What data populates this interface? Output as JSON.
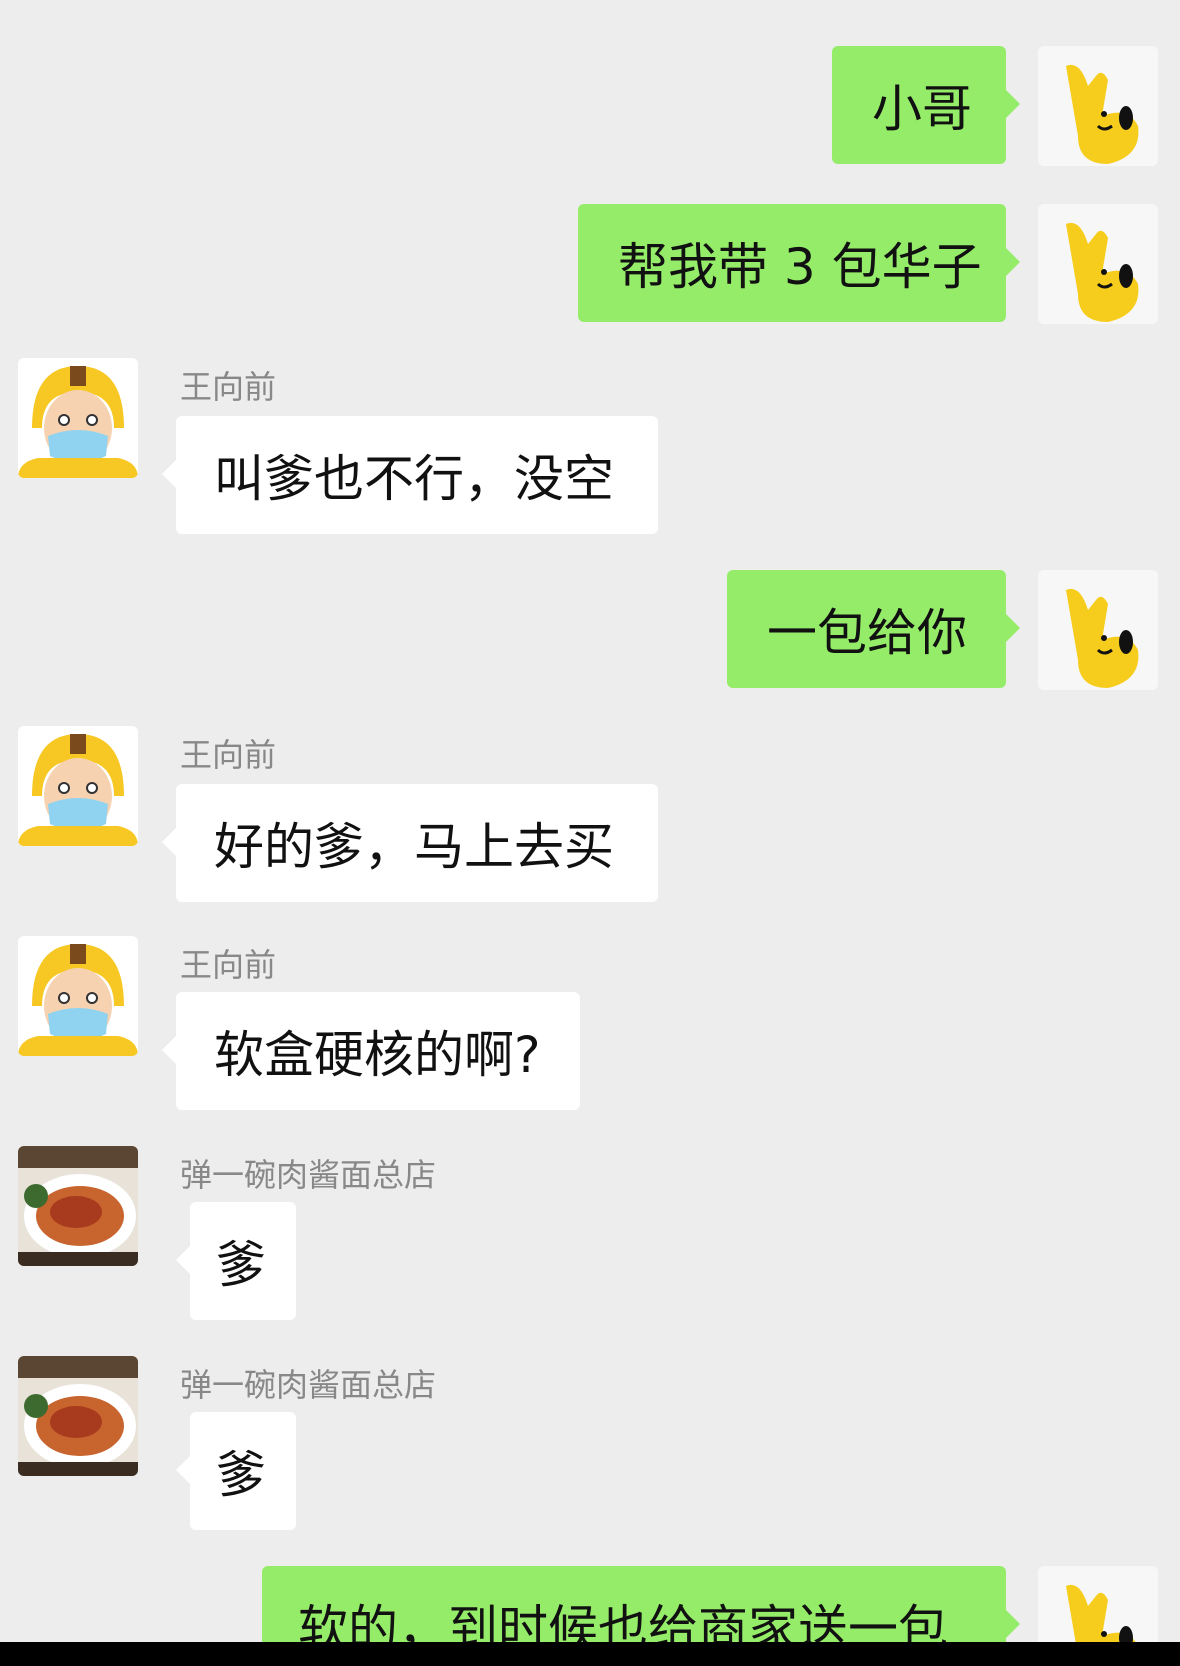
{
  "messages": [
    {
      "from": "me",
      "text": "小哥"
    },
    {
      "from": "me",
      "text": "帮我带 3 包华子"
    },
    {
      "from": "other",
      "sender": "王向前",
      "text": "叫爹也不行，没空"
    },
    {
      "from": "me",
      "text": "一包给你"
    },
    {
      "from": "other",
      "sender": "王向前",
      "text": "好的爹，马上去买"
    },
    {
      "from": "other",
      "sender": "王向前",
      "text": "软盒硬核的啊?"
    },
    {
      "from": "other",
      "sender": "弹一碗肉酱面总店",
      "text": "爹"
    },
    {
      "from": "other",
      "sender": "弹一碗肉酱面总店",
      "text": "爹"
    },
    {
      "from": "me",
      "text": "软的，到时候也给商家送一包"
    }
  ],
  "colors": {
    "background": "#ededed",
    "outgoing_bubble": "#95ec69",
    "incoming_bubble": "#ffffff",
    "sender_name": "#888888"
  },
  "icons": {
    "my_avatar": "yellow-cartoon-mascot-icon",
    "courier_avatar": "delivery-rider-helmet-mask-icon",
    "shop_avatar": "noodle-dish-photo-icon"
  }
}
